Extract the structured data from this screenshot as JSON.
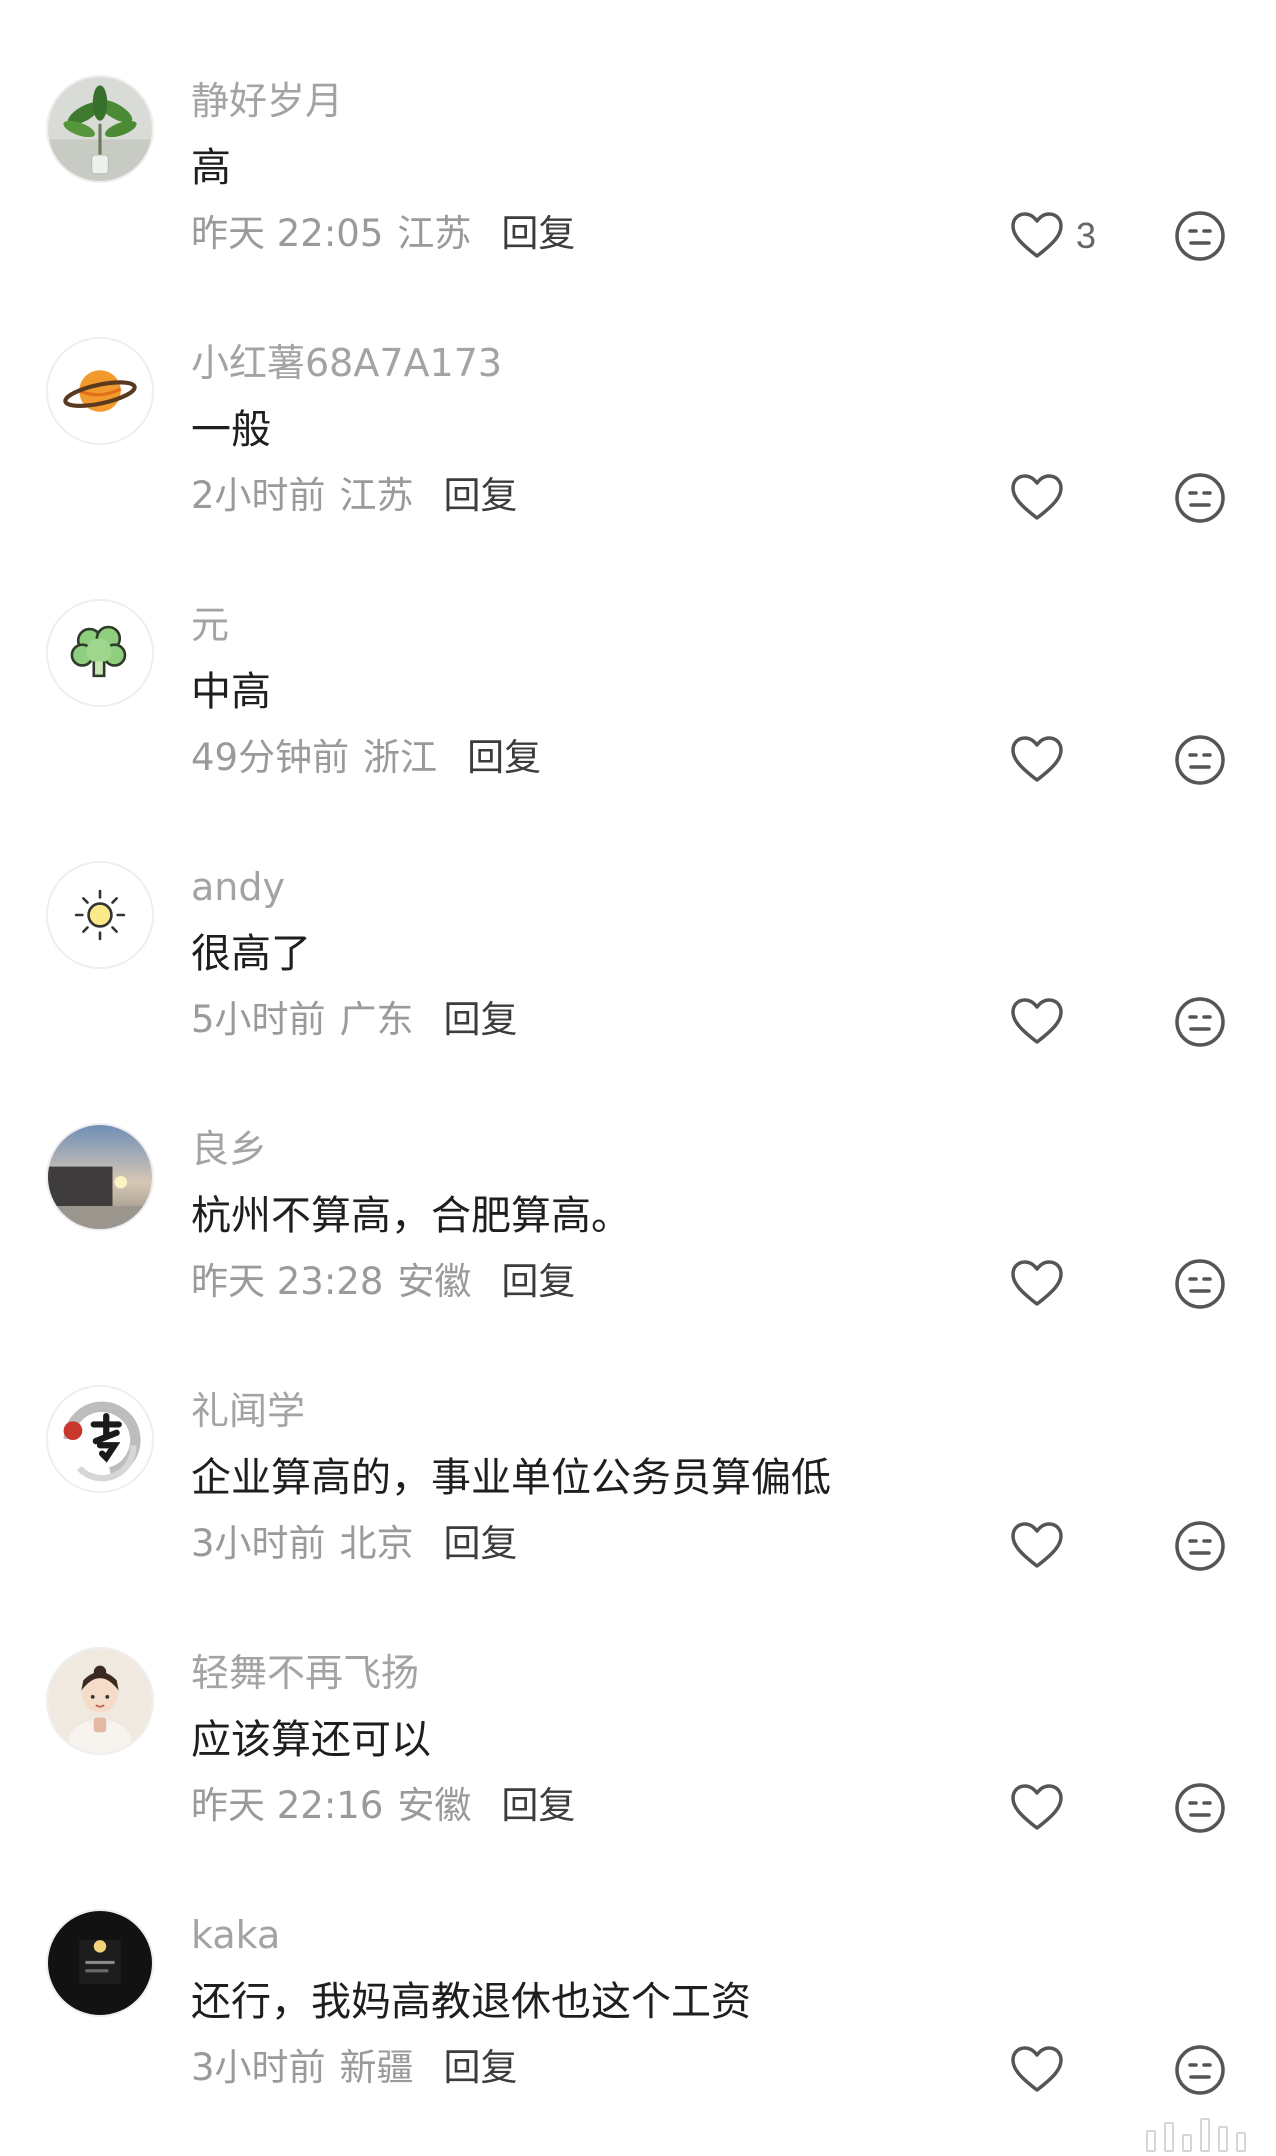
{
  "comments": [
    {
      "username": "静好岁月",
      "text": "高",
      "time": "昨天 22:05",
      "region": "江苏",
      "reply": "回复",
      "likes": "3",
      "avatar": "plant-avatar"
    },
    {
      "username": "小红薯68A7A173",
      "text": "一般",
      "time": "2小时前",
      "region": "江苏",
      "reply": "回复",
      "likes": "",
      "avatar": "planet-avatar"
    },
    {
      "username": "元",
      "text": "中高",
      "time": "49分钟前",
      "region": "浙江",
      "reply": "回复",
      "likes": "",
      "avatar": "broccoli-avatar"
    },
    {
      "username": "andy",
      "text": "很高了",
      "time": "5小时前",
      "region": "广东",
      "reply": "回复",
      "likes": "",
      "avatar": "sun-avatar"
    },
    {
      "username": "良乡",
      "text": "杭州不算高，合肥算高。",
      "time": "昨天 23:28",
      "region": "安徽",
      "reply": "回复",
      "likes": "",
      "avatar": "sunset-avatar"
    },
    {
      "username": "礼闻学",
      "text": "企业算高的，事业单位公务员算偏低",
      "time": "3小时前",
      "region": "北京",
      "reply": "回复",
      "likes": "",
      "avatar": "calligraphy-avatar"
    },
    {
      "username": "轻舞不再飞扬",
      "text": "应该算还可以",
      "time": "昨天 22:16",
      "region": "安徽",
      "reply": "回复",
      "likes": "",
      "avatar": "girl-avatar"
    },
    {
      "username": "kaka",
      "text": "还行，我妈高教退休也这个工资",
      "time": "3小时前",
      "region": "新疆",
      "reply": "回复",
      "likes": "",
      "avatar": "night-avatar"
    }
  ],
  "colors": {
    "username": "#a3a3a3",
    "text": "#1e1e1e",
    "meta": "#9a9a9a",
    "reply": "#3c3c3c",
    "icon": "#555555"
  },
  "icons": {
    "like": "heart-outline-icon",
    "dislike": "meh-face-icon"
  }
}
